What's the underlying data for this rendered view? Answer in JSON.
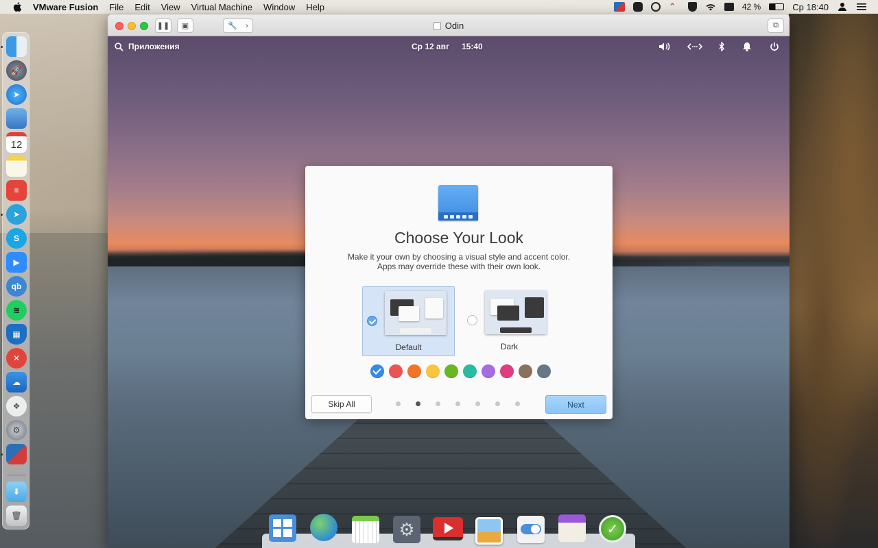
{
  "host_menubar": {
    "app_name": "VMware Fusion",
    "menus": [
      "File",
      "Edit",
      "View",
      "Virtual Machine",
      "Window",
      "Help"
    ],
    "battery": "42 %",
    "clock": "Ср 18:40"
  },
  "vm_window": {
    "title": "Odin"
  },
  "guest_panel": {
    "applications": "Приложения",
    "date": "Ср 12 авг",
    "time": "15:40"
  },
  "dialog": {
    "title": "Choose Your Look",
    "description_line1": "Make it your own by choosing a visual style and accent color.",
    "description_line2": "Apps may override these with their own look.",
    "styles": [
      {
        "label": "Default",
        "selected": true
      },
      {
        "label": "Dark",
        "selected": false
      }
    ],
    "accent_colors": [
      "#3689e6",
      "#ed5353",
      "#f37329",
      "#f9c440",
      "#68b723",
      "#28bca3",
      "#a56de2",
      "#de3e80",
      "#8a715e",
      "#667885"
    ],
    "selected_accent": 0,
    "skip_label": "Skip All",
    "next_label": "Next",
    "page_count": 7,
    "current_page": 2
  },
  "host_dock_icons": [
    "finder-icon",
    "launchpad-icon",
    "safari-icon",
    "preview-icon",
    "calendar-icon",
    "notes-icon",
    "todoist-icon",
    "telegram-icon",
    "skype-icon",
    "zoom-icon",
    "qbittorrent-icon",
    "spotify-icon",
    "adguard-icon",
    "anydesk-icon",
    "cloud-mail-icon",
    "bettertouch-icon",
    "system-preferences-icon",
    "vmware-fusion-icon",
    "downloads-folder-icon",
    "trash-icon"
  ],
  "guest_dock_icons": [
    "multitasking-view-icon",
    "web-browser-icon",
    "calendar-icon",
    "system-settings-icon",
    "videos-icon",
    "photos-icon",
    "switchboard-toggle-icon",
    "appcenter-icon",
    "onboarding-icon"
  ]
}
